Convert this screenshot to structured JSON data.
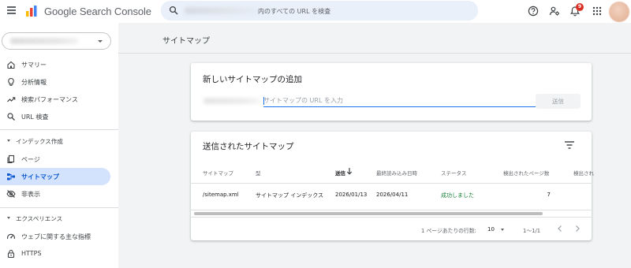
{
  "app": {
    "name": "Google Search Console"
  },
  "search": {
    "placeholder": "内のすべての URL を検査"
  },
  "header": {
    "notification_count": "9"
  },
  "sidebar": {
    "items": [
      {
        "label": "サマリー",
        "icon": "home-icon"
      },
      {
        "label": "分析情報",
        "icon": "lightbulb-icon"
      },
      {
        "label": "検索パフォーマンス",
        "icon": "trending-up-icon"
      },
      {
        "label": "URL 検査",
        "icon": "search-icon"
      }
    ],
    "index_section": {
      "label": "インデックス作成",
      "items": [
        {
          "label": "ページ",
          "icon": "pages-icon"
        },
        {
          "label": "サイトマップ",
          "icon": "sitemap-icon",
          "active": true
        },
        {
          "label": "非表示",
          "icon": "eye-off-icon"
        }
      ]
    },
    "experience_section": {
      "label": "エクスペリエンス",
      "items": [
        {
          "label": "ウェブに関する主な指標",
          "icon": "gauge-icon"
        },
        {
          "label": "HTTPS",
          "icon": "lock-icon"
        }
      ]
    }
  },
  "main": {
    "page_title": "サイトマップ",
    "add_card": {
      "title": "新しいサイトマップの追加",
      "input_placeholder": "サイトマップの URL を入力",
      "input_value": "",
      "submit_label": "送信"
    },
    "submitted_card": {
      "title": "送信されたサイトマップ",
      "columns": [
        "サイトマップ",
        "型",
        "送信",
        "最終読み込み日時",
        "ステータス",
        "検出されたページ数",
        "検出され"
      ],
      "rows": [
        {
          "sitemap": "/sitemap.xml",
          "type": "サイトマップ インデックス",
          "submitted": "2026/01/13",
          "last_read": "2026/04/11",
          "status": "成功しました",
          "pages": "7"
        }
      ],
      "footer": {
        "rows_per_page_label": "1 ページあたりの行数:",
        "rows_per_page": "10",
        "range": "1〜1/1"
      }
    }
  },
  "colors": {
    "accent": "#1a73e8",
    "active_nav_bg": "#d3e3fd",
    "success": "#188038",
    "badge": "#d93025"
  }
}
